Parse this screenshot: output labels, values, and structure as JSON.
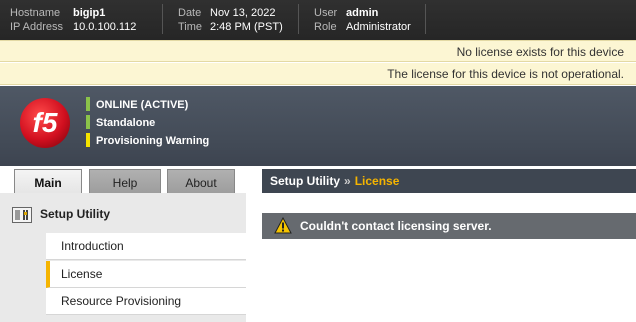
{
  "topbar": {
    "hostname_label": "Hostname",
    "hostname": "bigip1",
    "ip_label": "IP Address",
    "ip": "10.0.100.112",
    "date_label": "Date",
    "date": "Nov 13, 2022",
    "time_label": "Time",
    "time": "2:48 PM (PST)",
    "user_label": "User",
    "user": "admin",
    "role_label": "Role",
    "role": "Administrator"
  },
  "notices": [
    "No license exists for this device",
    "The license for this device is not operational."
  ],
  "status": {
    "items": [
      {
        "label": "ONLINE (ACTIVE)",
        "color": "#8bc34a"
      },
      {
        "label": "Standalone",
        "color": "#8bc34a"
      },
      {
        "label": "Provisioning Warning",
        "color": "#f5e400"
      }
    ]
  },
  "logo_text": "f5",
  "tabs": [
    "Main",
    "Help",
    "About"
  ],
  "breadcrumb": {
    "parent": "Setup Utility",
    "separator": "»",
    "current": "License"
  },
  "sidebar": {
    "heading": "Setup Utility",
    "items": [
      "Introduction",
      "License",
      "Resource Provisioning"
    ]
  },
  "alert": {
    "message": "Couldn't contact licensing server."
  },
  "colors": {
    "accent": "#f5b400",
    "header": "#4a525e",
    "alert_bg": "#666a6f"
  }
}
